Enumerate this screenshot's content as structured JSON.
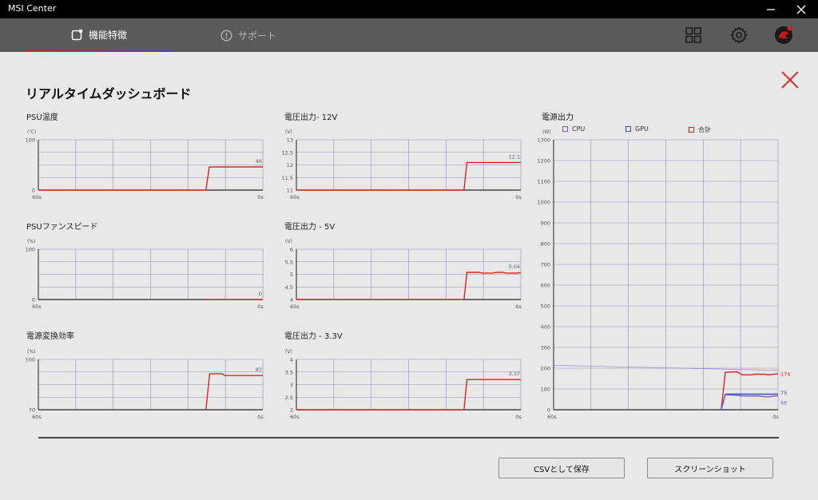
{
  "app": {
    "title": "MSI Center"
  },
  "nav": {
    "tabs": [
      {
        "label": "機能特徴",
        "active": true,
        "icon": "feature-icon"
      },
      {
        "label": "サポート",
        "active": false,
        "icon": "support-icon"
      }
    ],
    "icons": [
      "grid-icon",
      "gear-icon",
      "dragon-avatar-icon"
    ]
  },
  "page": {
    "title": "リアルタイムダッシュボード"
  },
  "colors": {
    "total": "#dd2222",
    "cpu": "#7b5dc7",
    "gpu": "#3c45c0",
    "grid": "#8e90ad",
    "axis": "#222222"
  },
  "charts": [
    {
      "id": "psu-temp",
      "title": "PSU温度",
      "unit": "(℃)",
      "y_ticks": [
        "100",
        "0"
      ],
      "ylim": [
        0,
        100
      ],
      "x_start": "60s",
      "x_end": "0s",
      "value_label": "46",
      "series": [
        {
          "key": "total",
          "values": [
            [
              60,
              0
            ],
            [
              15.2,
              0
            ],
            [
              14.3,
              46
            ],
            [
              0,
              46
            ]
          ]
        }
      ]
    },
    {
      "id": "v12",
      "title": "電圧出力- 12V",
      "unit": "(V)",
      "y_ticks": [
        "13",
        "12.5",
        "12",
        "11.5",
        "11"
      ],
      "ylim": [
        11,
        13
      ],
      "x_start": "60s",
      "x_end": "0s",
      "value_label": "12.1",
      "series": [
        {
          "key": "total",
          "values": [
            [
              60,
              11
            ],
            [
              15.2,
              11
            ],
            [
              14.4,
              12.1
            ],
            [
              0,
              12.1
            ]
          ]
        }
      ]
    },
    {
      "id": "psu-fan",
      "title": "PSUファンスピード",
      "unit": "(%)",
      "y_ticks": [
        "100",
        "0"
      ],
      "ylim": [
        0,
        100
      ],
      "x_start": "60s",
      "x_end": "0s",
      "value_label": "0",
      "series": [
        {
          "key": "total",
          "values": [
            [
              15.2,
              0
            ],
            [
              0,
              0
            ]
          ]
        }
      ]
    },
    {
      "id": "v5",
      "title": "電圧出力 - 5V",
      "unit": "(V)",
      "y_ticks": [
        "6",
        "5.5",
        "5",
        "4.5",
        "4"
      ],
      "ylim": [
        4,
        6
      ],
      "x_start": "60s",
      "x_end": "0s",
      "value_label": "5.04",
      "series": [
        {
          "key": "total",
          "values": [
            [
              60,
              4
            ],
            [
              15.2,
              4
            ],
            [
              14.4,
              5.08
            ],
            [
              11,
              5.08
            ],
            [
              10.2,
              5.05
            ],
            [
              7.5,
              5.05
            ],
            [
              6.6,
              5.08
            ],
            [
              4.8,
              5.08
            ],
            [
              4.0,
              5.05
            ],
            [
              1.2,
              5.05
            ],
            [
              0,
              5.08
            ]
          ]
        }
      ]
    },
    {
      "id": "efficiency",
      "title": "電源変換効率",
      "unit": "(%)",
      "y_ticks": [
        "100",
        "70"
      ],
      "ylim": [
        70,
        100
      ],
      "x_start": "60s",
      "x_end": "0s",
      "value_label": "87",
      "series": [
        {
          "key": "total",
          "values": [
            [
              15.2,
              70
            ],
            [
              14.2,
              91.5
            ],
            [
              10.9,
              91.5
            ],
            [
              10.1,
              90.4
            ],
            [
              0,
              90.4
            ]
          ]
        }
      ]
    },
    {
      "id": "v33",
      "title": "電圧出力 - 3.3V",
      "unit": "(V)",
      "y_ticks": [
        "4",
        "3.5",
        "3",
        "2.5",
        "2"
      ],
      "ylim": [
        2,
        4
      ],
      "x_start": "60s",
      "x_end": "0s",
      "value_label": "3.37",
      "series": [
        {
          "key": "total",
          "values": [
            [
              60,
              2
            ],
            [
              15.2,
              2
            ],
            [
              14.4,
              3.2
            ],
            [
              0,
              3.2
            ]
          ]
        }
      ]
    }
  ],
  "power_chart": {
    "id": "power",
    "title": "電源出力",
    "unit": "(W)",
    "y_ticks": [
      "1300",
      "1200",
      "1100",
      "1000",
      "900",
      "800",
      "700",
      "600",
      "500",
      "400",
      "300",
      "200",
      "100",
      "0"
    ],
    "ylim": [
      0,
      1300
    ],
    "x_start": "60s",
    "x_end": "0s",
    "legend": [
      {
        "key": "cpu",
        "label": "CPU"
      },
      {
        "key": "gpu",
        "label": "GPU"
      },
      {
        "key": "total",
        "label": "合計"
      }
    ],
    "end_labels": [
      {
        "key": "total",
        "text": "174"
      },
      {
        "key": "gpu",
        "text": "75"
      },
      {
        "key": "cpu",
        "text": "66"
      }
    ],
    "series": [
      {
        "key": "total",
        "values": [
          [
            15.2,
            0
          ],
          [
            14.1,
            180
          ],
          [
            11.0,
            183
          ],
          [
            9.6,
            168
          ],
          [
            7.5,
            168
          ],
          [
            6.1,
            171
          ],
          [
            4.0,
            171
          ],
          [
            2.5,
            168
          ],
          [
            0,
            174
          ]
        ]
      },
      {
        "key": "gpu",
        "values": [
          [
            15.2,
            0
          ],
          [
            14.1,
            75
          ],
          [
            0,
            75
          ]
        ]
      },
      {
        "key": "cpu",
        "values": [
          [
            15.2,
            0
          ],
          [
            14.1,
            72
          ],
          [
            11.0,
            70
          ],
          [
            9.6,
            66
          ],
          [
            5.5,
            66
          ],
          [
            4.1,
            64
          ],
          [
            2.6,
            62
          ],
          [
            1.0,
            66
          ],
          [
            0,
            66
          ]
        ]
      },
      {
        "key": "cpu",
        "faint": true,
        "values": [
          [
            60,
            214
          ],
          [
            0,
            190
          ]
        ]
      }
    ]
  },
  "buttons": {
    "csv": "CSVとして保存",
    "screenshot": "スクリーンショット"
  }
}
